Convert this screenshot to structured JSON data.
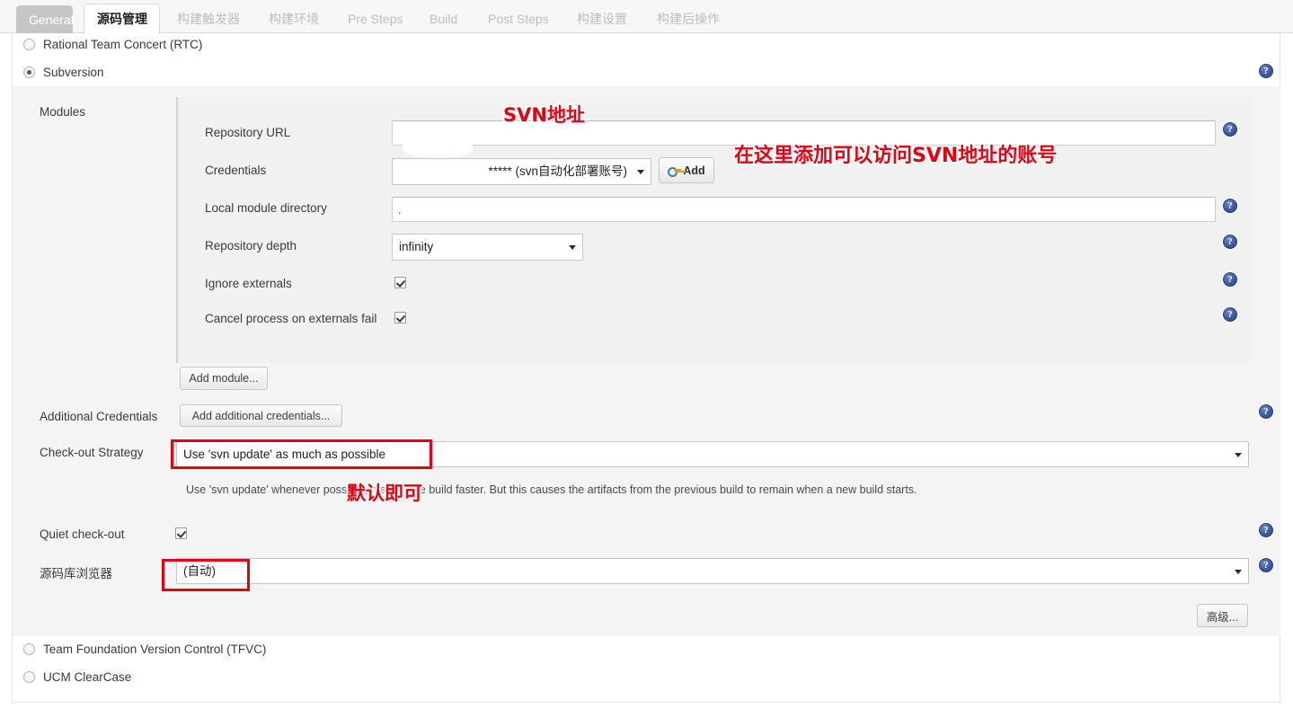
{
  "tabs": [
    {
      "label": "General",
      "state": "muted"
    },
    {
      "label": "源码管理",
      "state": "active"
    },
    {
      "label": "构建触发器",
      "state": "normal"
    },
    {
      "label": "构建环境",
      "state": "normal"
    },
    {
      "label": "Pre Steps",
      "state": "normal"
    },
    {
      "label": "Build",
      "state": "normal"
    },
    {
      "label": "Post Steps",
      "state": "normal"
    },
    {
      "label": "构建设置",
      "state": "normal"
    },
    {
      "label": "构建后操作",
      "state": "normal"
    }
  ],
  "scm_options": {
    "rtc": {
      "label": "Rational Team Concert (RTC)",
      "selected": false
    },
    "subversion": {
      "label": "Subversion",
      "selected": true
    },
    "tfvc": {
      "label": "Team Foundation Version Control (TFVC)",
      "selected": false
    },
    "clearcase": {
      "label": "UCM ClearCase",
      "selected": false
    }
  },
  "modules": {
    "section_label": "Modules",
    "repository_url": {
      "label": "Repository URL",
      "value": "",
      "placeholder": ""
    },
    "credentials": {
      "label": "Credentials",
      "value": "***** (svn自动化部署账号)",
      "add_button": "Add",
      "add_button_icon": "key-icon"
    },
    "local_module_directory": {
      "label": "Local module directory",
      "value": "."
    },
    "repository_depth": {
      "label": "Repository depth",
      "value": "infinity"
    },
    "ignore_externals": {
      "label": "Ignore externals",
      "checked": true
    },
    "cancel_process_on_externals_fail": {
      "label": "Cancel process on externals fail",
      "checked": true
    },
    "add_module_button": "Add module..."
  },
  "additional_credentials": {
    "label": "Additional Credentials",
    "button": "Add additional credentials..."
  },
  "checkout_strategy": {
    "label": "Check-out Strategy",
    "value": "Use 'svn update' as much as possible",
    "description": "Use 'svn update' whenever possible, making the build faster. But this causes the artifacts from the previous build to remain when a new build starts."
  },
  "quiet_checkout": {
    "label": "Quiet check-out",
    "checked": true
  },
  "repository_browser": {
    "label": "源码库浏览器",
    "value": "(自动)"
  },
  "advanced_button": "高级...",
  "annotations": [
    {
      "text": "SVN地址",
      "name": "annotation-svn-url"
    },
    {
      "text": "在这里添加可以访问SVN地址的账号",
      "name": "annotation-add-credentials"
    },
    {
      "text": "默认即可",
      "name": "annotation-default-ok"
    }
  ],
  "help_icon_glyph": "?",
  "colors": {
    "annotation_red": "#e60012",
    "help_blue": "#3b5ba5",
    "active_tab_text": "#1f1f1f",
    "muted_tab_bg": "#c6c6c6"
  }
}
